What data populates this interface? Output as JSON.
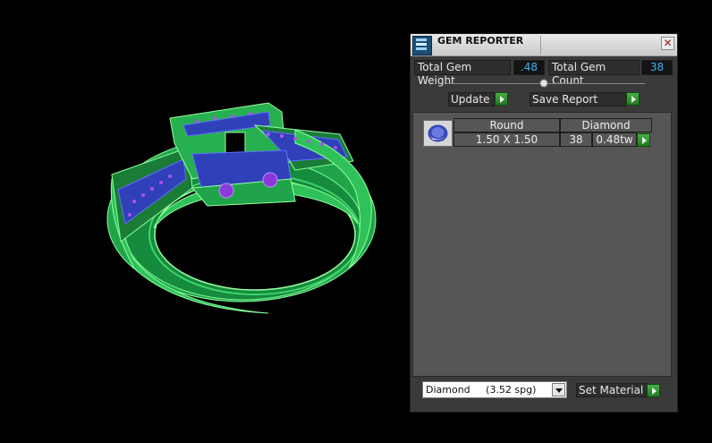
{
  "viewport": {
    "label": "3D viewport",
    "colors": {
      "metal": "#2fc25a",
      "metal_dark": "#159a3c",
      "gem_blue": "#2f40b8",
      "gem_purple": "#8a3ad8"
    }
  },
  "panel": {
    "title": "GEM REPORTER",
    "close_icon": "close-icon",
    "stats": {
      "total_weight_label": "Total Gem Weight",
      "total_weight_value": ".48",
      "total_count_label": "Total Gem Count",
      "total_count_value": "38"
    },
    "slider": {
      "value_fraction": 0.5
    },
    "update_label": "Update",
    "save_report_label": "Save Report",
    "gem_rows": [
      {
        "cut": "Round",
        "material": "Diamond",
        "size": "1.50 X 1.50",
        "count": "38",
        "weight": "0.48tw"
      }
    ],
    "material_select": {
      "value": "Diamond     (3.52 spg)"
    },
    "set_material_label": "Set Material"
  }
}
